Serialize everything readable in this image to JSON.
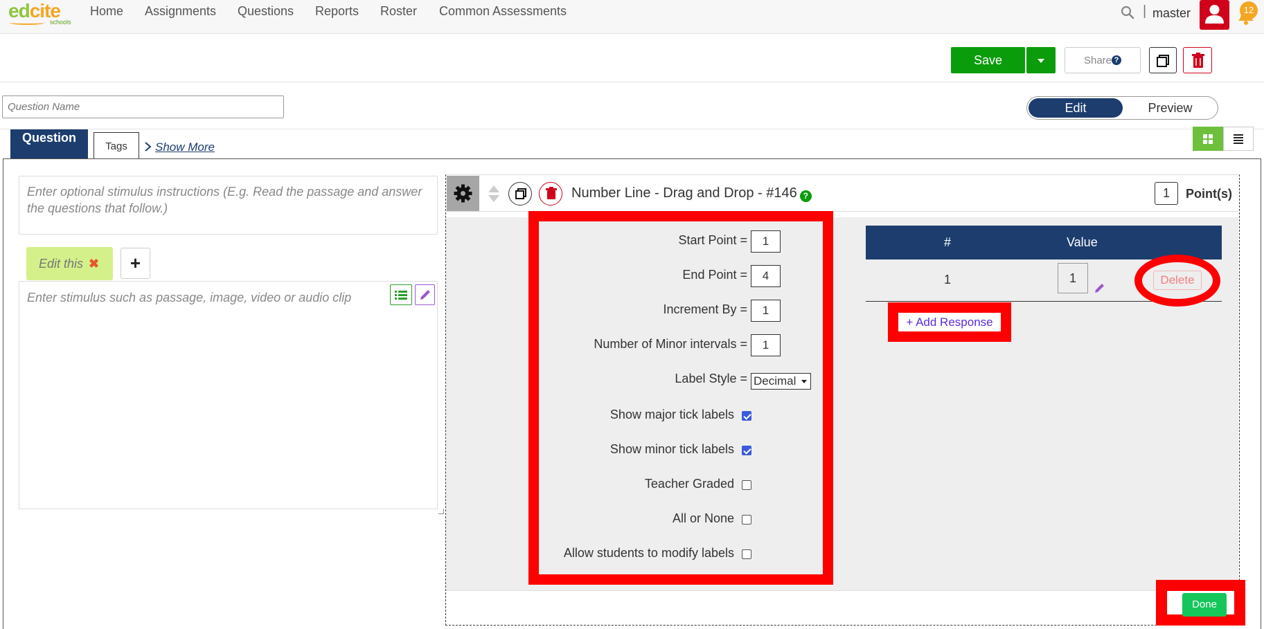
{
  "brand": {
    "name_part1": "ed",
    "name_part2": "cite",
    "tagline": "schools"
  },
  "nav": {
    "items": [
      "Home",
      "Assignments",
      "Questions",
      "Reports",
      "Roster",
      "Common Assessments"
    ],
    "separator": "|",
    "user": "master",
    "notifications": "12"
  },
  "toolbar": {
    "save": "Save",
    "share": "Share",
    "share_help": "?"
  },
  "question_name": {
    "placeholder": "Question Name",
    "value": ""
  },
  "mode_toggle": {
    "edit": "Edit",
    "preview": "Preview",
    "active": "Edit"
  },
  "tabs": {
    "question": "Question",
    "tags": "Tags",
    "show_more": "Show More"
  },
  "left": {
    "instructions_placeholder": "Enter optional stimulus instructions (E.g. Read the passage and answer the questions that follow.)",
    "tab_label": "Edit this",
    "tab_close": "✖",
    "add_tab": "+",
    "stimulus_placeholder": "Enter stimulus such as passage, image, video or audio clip"
  },
  "question": {
    "title": "Number Line - Drag and Drop - #146",
    "help": "?",
    "points": "1",
    "points_label": "Point(s)"
  },
  "settings": {
    "start_point": {
      "label": "Start Point =",
      "value": "1"
    },
    "end_point": {
      "label": "End Point =",
      "value": "4"
    },
    "increment": {
      "label": "Increment By =",
      "value": "1"
    },
    "minor_intervals": {
      "label": "Number of Minor intervals =",
      "value": "1"
    },
    "label_style": {
      "label": "Label Style =",
      "value": "Decimal"
    },
    "show_major": {
      "label": "Show major tick labels",
      "checked": true
    },
    "show_minor": {
      "label": "Show minor tick labels",
      "checked": true
    },
    "teacher_graded": {
      "label": "Teacher Graded",
      "checked": false
    },
    "all_or_none": {
      "label": "All or None",
      "checked": false
    },
    "allow_modify": {
      "label": "Allow students to modify labels",
      "checked": false
    }
  },
  "responses": {
    "col_index": "#",
    "col_value": "Value",
    "rows": [
      {
        "index": "1",
        "value": "1",
        "delete": "Delete"
      }
    ],
    "add": "+ Add Response"
  },
  "done": "Done",
  "colors": {
    "navy": "#1c3d6e",
    "green": "#0a9c0a",
    "highlight": "#ff0000",
    "done_green": "#15c65a"
  }
}
